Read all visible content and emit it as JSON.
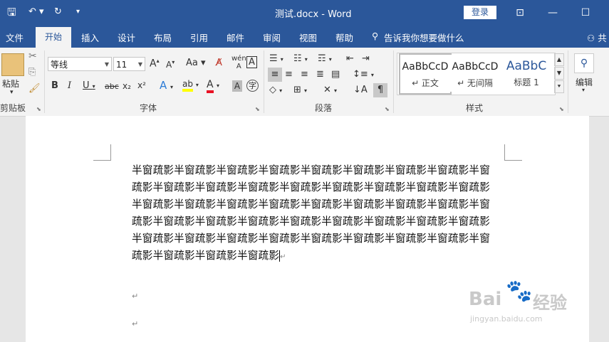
{
  "titlebar": {
    "doc_title": "测试.docx  -  Word",
    "login": "登录"
  },
  "tabs": [
    "文件",
    "开始",
    "插入",
    "设计",
    "布局",
    "引用",
    "邮件",
    "审阅",
    "视图",
    "帮助"
  ],
  "tell_me": "告诉我你想要做什么",
  "share": "共",
  "ribbon": {
    "clipboard": {
      "paste": "粘贴",
      "label": "剪贴板"
    },
    "font": {
      "name": "等线",
      "size": "11",
      "label": "字体",
      "bold": "B",
      "italic": "I",
      "underline": "U",
      "strike": "abc",
      "sub": "x₂",
      "sup": "x²",
      "grow": "A",
      "shrink": "A",
      "case": "Aa",
      "wen": "wén",
      "phon": "A",
      "char_border": "A",
      "highlight_char": "ab",
      "color_char": "A",
      "shade_char": "A",
      "circle_char": "字"
    },
    "paragraph": {
      "label": "段落"
    },
    "styles": {
      "label": "样式",
      "items": [
        {
          "sample": "AaBbCcD",
          "name": "↵ 正文"
        },
        {
          "sample": "AaBbCcD",
          "name": "↵ 无间隔"
        },
        {
          "sample": "AaBbC",
          "name": "标题 1"
        }
      ]
    },
    "editing": {
      "label": "编辑"
    }
  },
  "document": {
    "text": "半窗疏影半窗疏影半窗疏影半窗疏影半窗疏影半窗疏影半窗疏影半窗疏影半窗疏影半窗疏影半窗疏影半窗疏影半窗疏影半窗疏影半窗疏影半窗疏影半窗疏影半窗疏影半窗疏影半窗疏影半窗疏影半窗疏影半窗疏影半窗疏影半窗疏影半窗疏影半窗疏影半窗疏影半窗疏影半窗疏影半窗疏影半窗疏影半窗疏影半窗疏影半窗疏影半窗疏影半窗疏影半窗疏影半窗疏影半窗疏影半窗疏影半窗疏影半窗疏影半窗疏影半窗疏影半窗疏影",
    "para_mark": "↵"
  },
  "watermark": {
    "brand": "Bai",
    "brand2": "经验",
    "url": "jingyan.baidu.com"
  },
  "colors": {
    "accent": "#2b579a",
    "highlight": "#ffff00",
    "font_color": "#e81123"
  }
}
